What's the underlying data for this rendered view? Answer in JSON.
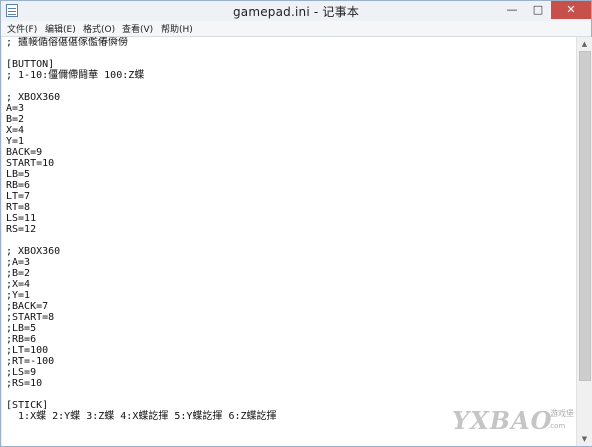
{
  "window": {
    "title": "gamepad.ini - 记事本",
    "controls": {
      "minimize": "—",
      "maximize": "□",
      "close": "✕"
    }
  },
  "menu": [
    {
      "label": "文件(F)"
    },
    {
      "label": "编辑(E)"
    },
    {
      "label": "格式(O)"
    },
    {
      "label": "查看(V)"
    },
    {
      "label": "帮助(H)"
    }
  ],
  "editor": {
    "lines": [
      "; 攎帹偱傛偡偡傢儖偆僢僗",
      "",
      "[BUTTON]",
      "; 1-10:僵儞僀鬪華 100:Z蝶",
      "",
      "; XBOX360",
      "A=3",
      "B=2",
      "X=4",
      "Y=1",
      "BACK=9",
      "START=10",
      "LB=5",
      "RB=6",
      "LT=7",
      "RT=8",
      "LS=11",
      "RS=12",
      "",
      "; XBOX360",
      ";A=3",
      ";B=2",
      ";X=4",
      ";Y=1",
      ";BACK=7",
      ";START=8",
      ";LB=5",
      ";RB=6",
      ";LT=100",
      ";RT=-100",
      ";LS=9",
      ";RS=10",
      "",
      "[STICK]",
      "  1:X蝶 2:Y蝶 3:Z蝶 4:X蝶訖揮 5:Y蝶訖揮 6:Z蝶訖揮"
    ]
  },
  "scrollbar": {
    "up_arrow": "▲",
    "down_arrow": "▼"
  },
  "watermark": {
    "logo": "YXBAO",
    "tag": "游戏堡",
    "domain": ".com"
  }
}
